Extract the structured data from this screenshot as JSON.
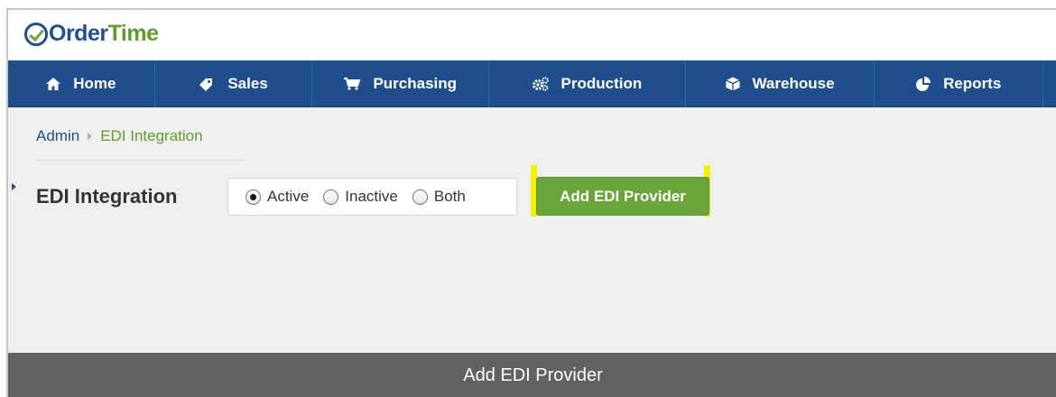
{
  "app": {
    "logo_order": "Order",
    "logo_time": "Time"
  },
  "nav": {
    "items": [
      {
        "label": "Home",
        "icon": "home-icon"
      },
      {
        "label": "Sales",
        "icon": "tag-icon"
      },
      {
        "label": "Purchasing",
        "icon": "cart-icon"
      },
      {
        "label": "Production",
        "icon": "gears-icon"
      },
      {
        "label": "Warehouse",
        "icon": "box-icon"
      },
      {
        "label": "Reports",
        "icon": "pie-chart-icon"
      }
    ]
  },
  "breadcrumb": {
    "root": "Admin",
    "current": "EDI Integration"
  },
  "page": {
    "title": "EDI Integration"
  },
  "status_filter": {
    "options": [
      "Active",
      "Inactive",
      "Both"
    ],
    "selected": "Active"
  },
  "actions": {
    "add_label": "Add EDI Provider"
  },
  "caption": {
    "text": "Add EDI Provider"
  },
  "colors": {
    "brand_blue": "#1f4e8c",
    "brand_green": "#6aa53a",
    "highlight": "#f2f200",
    "caption_bg": "#626262"
  }
}
